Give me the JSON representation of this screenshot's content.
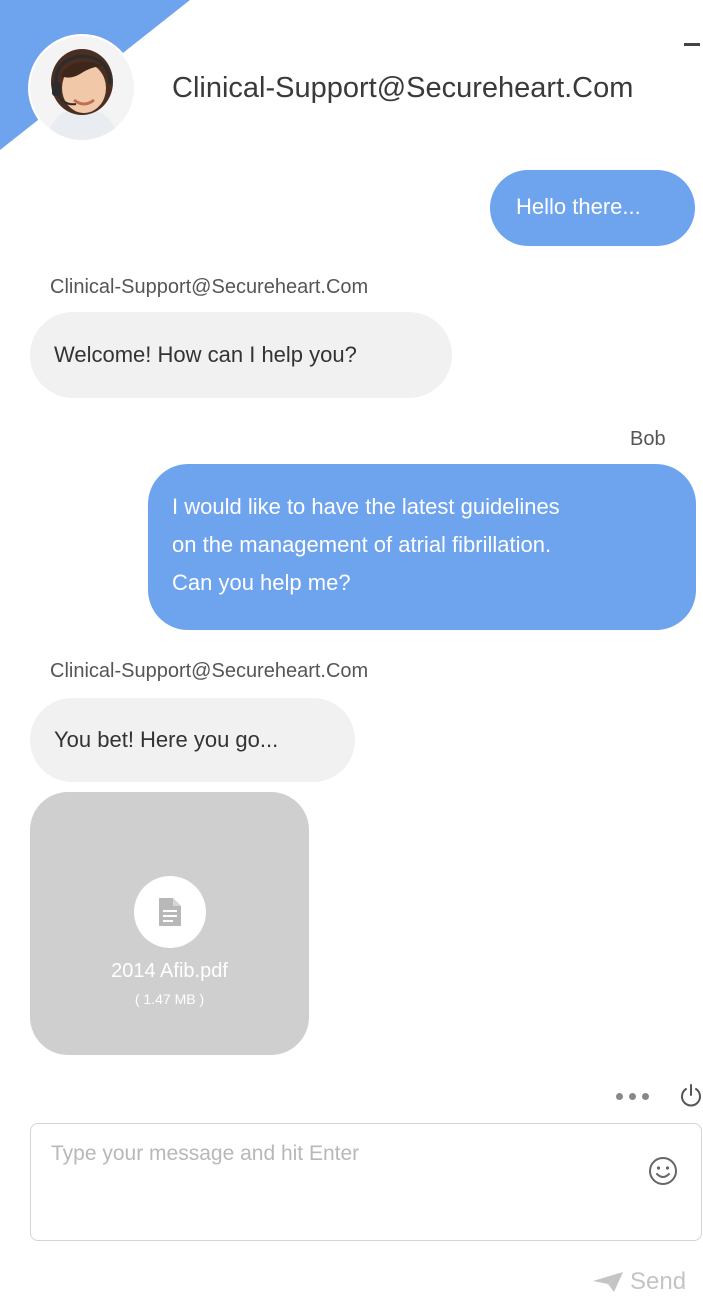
{
  "header": {
    "title": "Clinical-Support@Secureheart.Com",
    "avatar_icon": "support-agent-avatar",
    "minimize_icon": "minimize-icon"
  },
  "messages": [
    {
      "direction": "outgoing",
      "text": "Hello there..."
    },
    {
      "direction": "incoming",
      "sender": "Clinical-Support@Secureheart.Com",
      "text": "Welcome! How can I help you?"
    },
    {
      "direction": "outgoing",
      "sender": "Bob",
      "lines": [
        "I would like to have the latest guidelines",
        "on the management of atrial fibrillation.",
        "Can you help me?"
      ]
    },
    {
      "direction": "incoming",
      "sender": "Clinical-Support@Secureheart.Com",
      "text": "You bet! Here you go..."
    }
  ],
  "attachment": {
    "filename": "2014 Afib.pdf",
    "size": "( 1.47 MB )",
    "icon": "document-icon"
  },
  "toolbar": {
    "more_icon": "more-dots-icon",
    "power_icon": "power-icon"
  },
  "composer": {
    "placeholder": "Type your message and hit Enter",
    "value": "",
    "emoji_icon": "smiley-icon",
    "send_label": "Send",
    "send_icon": "paper-plane-icon"
  },
  "colors": {
    "accent": "#6ea3ee",
    "incoming_bubble": "#f1f1f1",
    "attachment_card": "#cfcfcf"
  }
}
